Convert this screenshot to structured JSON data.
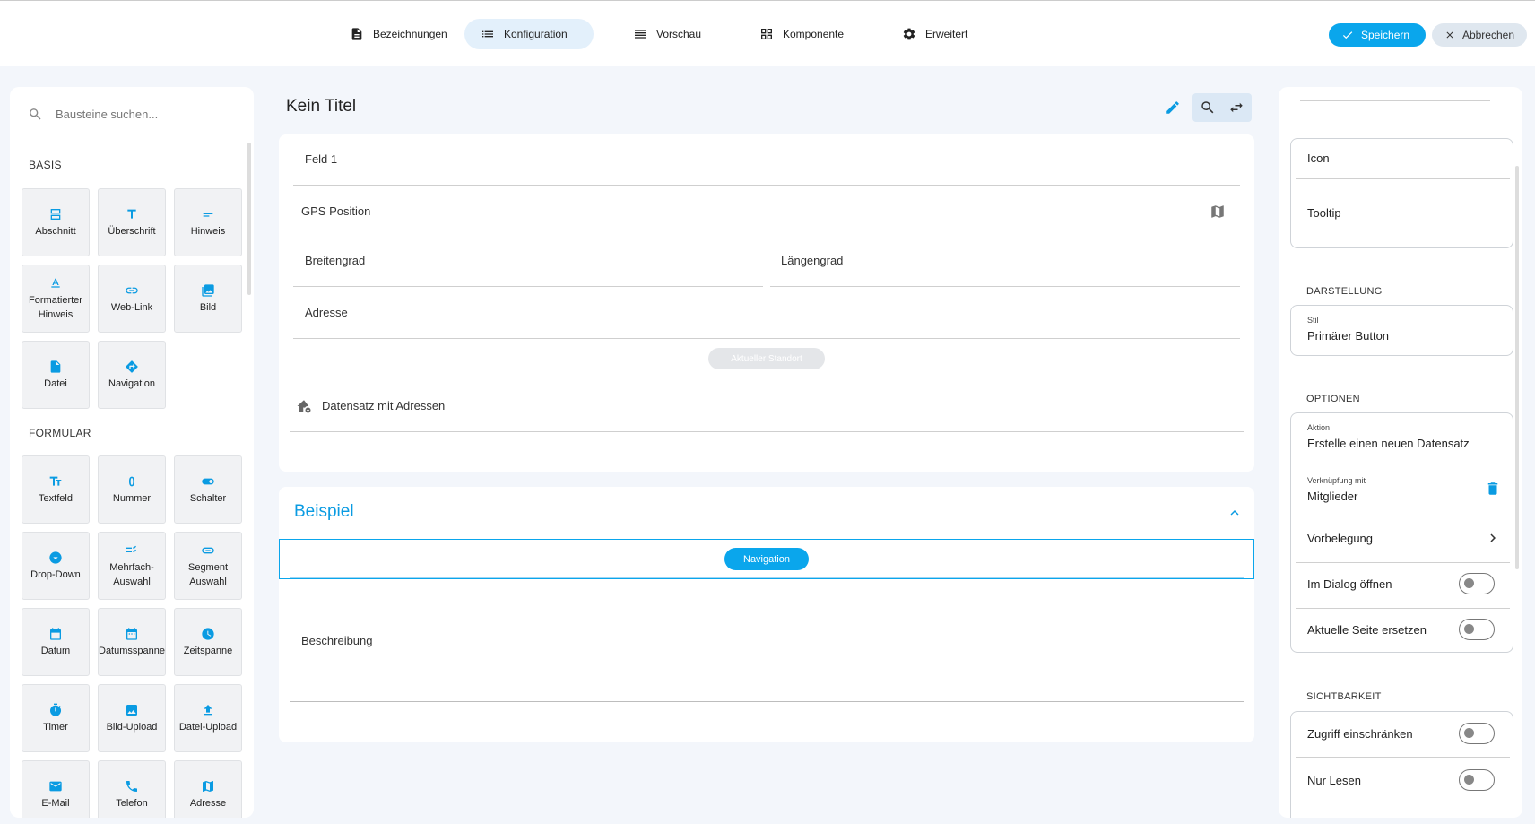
{
  "tabs": [
    {
      "label": "Bezeichnungen",
      "icon": "document-icon"
    },
    {
      "label": "Konfiguration",
      "icon": "list-icon",
      "active": true
    },
    {
      "label": "Vorschau",
      "icon": "table-icon"
    },
    {
      "label": "Komponente",
      "icon": "grid-icon"
    },
    {
      "label": "Erweitert",
      "icon": "gear-icon"
    }
  ],
  "actions": {
    "save_label": "Speichern",
    "cancel_label": "Abbrechen"
  },
  "palette": {
    "search_placeholder": "Bausteine suchen...",
    "sections": [
      {
        "title": "BASIS",
        "items": [
          "Abschnitt",
          "Überschrift",
          "Hinweis",
          "Formatierter Hinweis",
          "Web-Link",
          "Bild",
          "Datei",
          "Navigation"
        ]
      },
      {
        "title": "FORMULAR",
        "items": [
          "Textfeld",
          "Nummer",
          "Schalter",
          "Drop-Down",
          "Mehrfach-Auswahl",
          "Segment Auswahl",
          "Datum",
          "Datumsspanne",
          "Zeitspanne",
          "Timer",
          "Bild-Upload",
          "Datei-Upload",
          "E-Mail",
          "Telefon",
          "Adresse"
        ]
      }
    ]
  },
  "editor": {
    "title": "Kein Titel",
    "fields": {
      "feld1": "Feld 1",
      "gps": "GPS Position",
      "lat": "Breitengrad",
      "lng": "Längengrad",
      "adresse": "Adresse",
      "standort_button": "Aktueller Standort",
      "datensatz": "Datensatz mit Adressen"
    },
    "section": {
      "title": "Beispiel",
      "nav_button": "Navigation",
      "beschreibung": "Beschreibung"
    }
  },
  "properties": {
    "icon_label": "Icon",
    "tooltip_label": "Tooltip",
    "darstellung": {
      "title": "DARSTELLUNG",
      "stil_label": "Stil",
      "stil_value": "Primärer Button"
    },
    "optionen": {
      "title": "OPTIONEN",
      "aktion_label": "Aktion",
      "aktion_value": "Erstelle einen neuen Datensatz",
      "verknuepfung_label": "Verknüpfung mit",
      "verknuepfung_value": "Mitglieder",
      "vorbelegung": "Vorbelegung",
      "dialog": "Im Dialog öffnen",
      "ersetzen": "Aktuelle Seite ersetzen"
    },
    "sichtbarkeit": {
      "title": "SICHTBARKEIT",
      "zugriff": "Zugriff einschränken",
      "nur_lesen": "Nur Lesen"
    }
  },
  "colors": {
    "accent": "#0aa6ec",
    "background": "#f3f6fb"
  }
}
